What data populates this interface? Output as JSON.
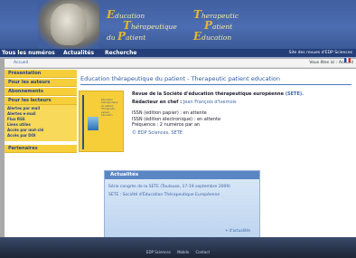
{
  "banner": {
    "logo_left": {
      "big1": "E",
      "word1": "ducation",
      "big2": "T",
      "word2": "hérapeutique",
      "prefix": "du",
      "big3": "P",
      "word3": "atient"
    },
    "logo_right": {
      "big1": "T",
      "word1": "herapeutic",
      "big2": "P",
      "word2": "atient",
      "big3": "E",
      "word3": "ducation"
    }
  },
  "nav": {
    "items": [
      "Tous les numéros",
      "Actualités",
      "Recherche"
    ],
    "right_text": "Site des revues d'EDP Sciences"
  },
  "subbar": {
    "home": "Accueil",
    "right": "Vous êtes ici : Accueil"
  },
  "sidebar": {
    "top_items": [
      "Présentation",
      "Pour les auteurs",
      "Abonnements",
      "Pour les lecteurs"
    ],
    "sub_items": [
      "Alertes par mail",
      "Alertes e-mail",
      "Flux RSS",
      "Liens utiles",
      "Accès par mot-clé",
      "Accès par DOI"
    ],
    "bottom_items": [
      "Partenaires"
    ]
  },
  "main": {
    "title": "Education thérapeutique du patient - Therapeutic patient education",
    "cover": {
      "lines": [
        "Education",
        "thérapeutique",
        "du patient",
        "Therapeutic",
        "patient",
        "education"
      ]
    },
    "info": {
      "l1": "Revue de la Société d'éducation thérapeutique européenne",
      "l1_link": "(SETE).",
      "l2_label": "Rédacteur en chef :",
      "l2_value": "Jean François d'Ivernois",
      "l3": "ISSN (édition papier) : en attente",
      "l4": "ISSN (édition électronique) : en attente",
      "l5": "Fréquence : 2 numéros par an",
      "l6": "© EDP Sciences, SETE"
    },
    "actus": {
      "head": "Actualités",
      "items": [
        "Série congrès de la SETE (Toulouse, 17-19 septembre 2009)",
        "SETE : Société d'Éducation Thérapeutique Européenne"
      ],
      "more": "+ d'actualités"
    }
  },
  "footer": {
    "links": [
      "EDP Sciences",
      "Mobile",
      "Contact"
    ]
  }
}
